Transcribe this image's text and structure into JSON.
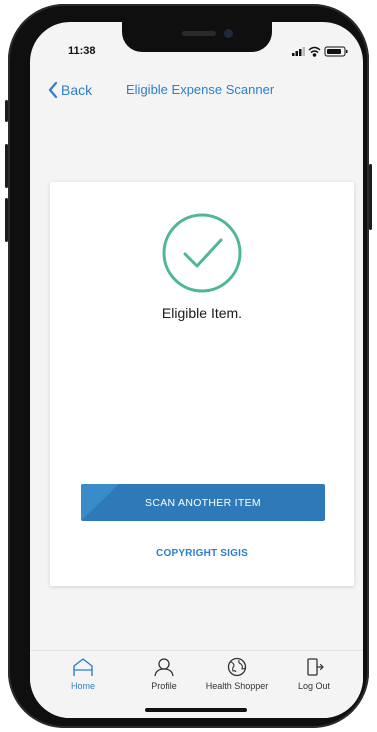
{
  "status_bar": {
    "time": "11:38"
  },
  "nav": {
    "back_label": "Back",
    "title": "Eligible Expense Scanner"
  },
  "result": {
    "icon": "check-circle-icon",
    "text": "Eligible Item."
  },
  "actions": {
    "scan_label": "SCAN ANOTHER ITEM",
    "copyright_label": "COPYRIGHT SIGIS"
  },
  "tabs": [
    {
      "label": "Home",
      "icon": "home-icon",
      "active": true
    },
    {
      "label": "Profile",
      "icon": "profile-icon",
      "active": false
    },
    {
      "label": "Health Shopper",
      "icon": "globe-icon",
      "active": false
    },
    {
      "label": "Log Out",
      "icon": "logout-icon",
      "active": false
    }
  ],
  "colors": {
    "accent": "#2b7fcd",
    "button": "#2e7ab8",
    "success": "#4fb893"
  }
}
